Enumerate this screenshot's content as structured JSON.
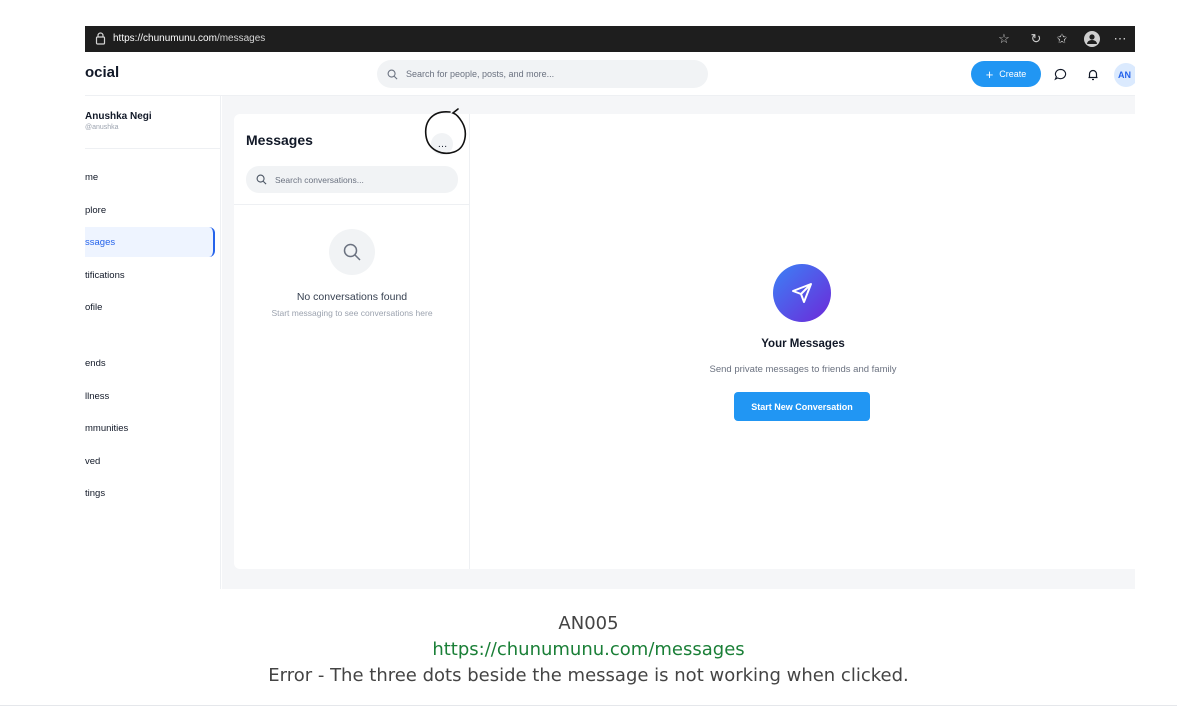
{
  "browser": {
    "url_domain": "https://chunumunu.com",
    "url_path": "/messages"
  },
  "header": {
    "brand": "ocial",
    "search_placeholder": "Search for people, posts, and more...",
    "create_label": "Create",
    "avatar_initials": "AN"
  },
  "sidebar": {
    "user_name": "Anushka Negi",
    "user_handle": "@anushka",
    "items": [
      {
        "label": "me"
      },
      {
        "label": "plore"
      },
      {
        "label": "ssages"
      },
      {
        "label": "tifications"
      },
      {
        "label": "ofile"
      },
      {
        "label": "ends"
      },
      {
        "label": "llness"
      },
      {
        "label": "mmunities"
      },
      {
        "label": "ved"
      },
      {
        "label": "tings"
      }
    ]
  },
  "messages": {
    "title": "Messages",
    "more_label": "…",
    "search_placeholder": "Search conversations...",
    "empty_title": "No conversations found",
    "empty_sub": "Start messaging to see conversations here"
  },
  "detail": {
    "title": "Your Messages",
    "subtitle": "Send private messages to friends and family",
    "start_button": "Start New Conversation"
  },
  "caption": {
    "id": "AN005",
    "url": "https://chunumunu.com/messages",
    "error": "Error - The three dots beside the message is not working when clicked."
  },
  "colors": {
    "accent": "#2196f3",
    "active_nav": "#2563eb",
    "caption_url": "#1a7f37"
  }
}
